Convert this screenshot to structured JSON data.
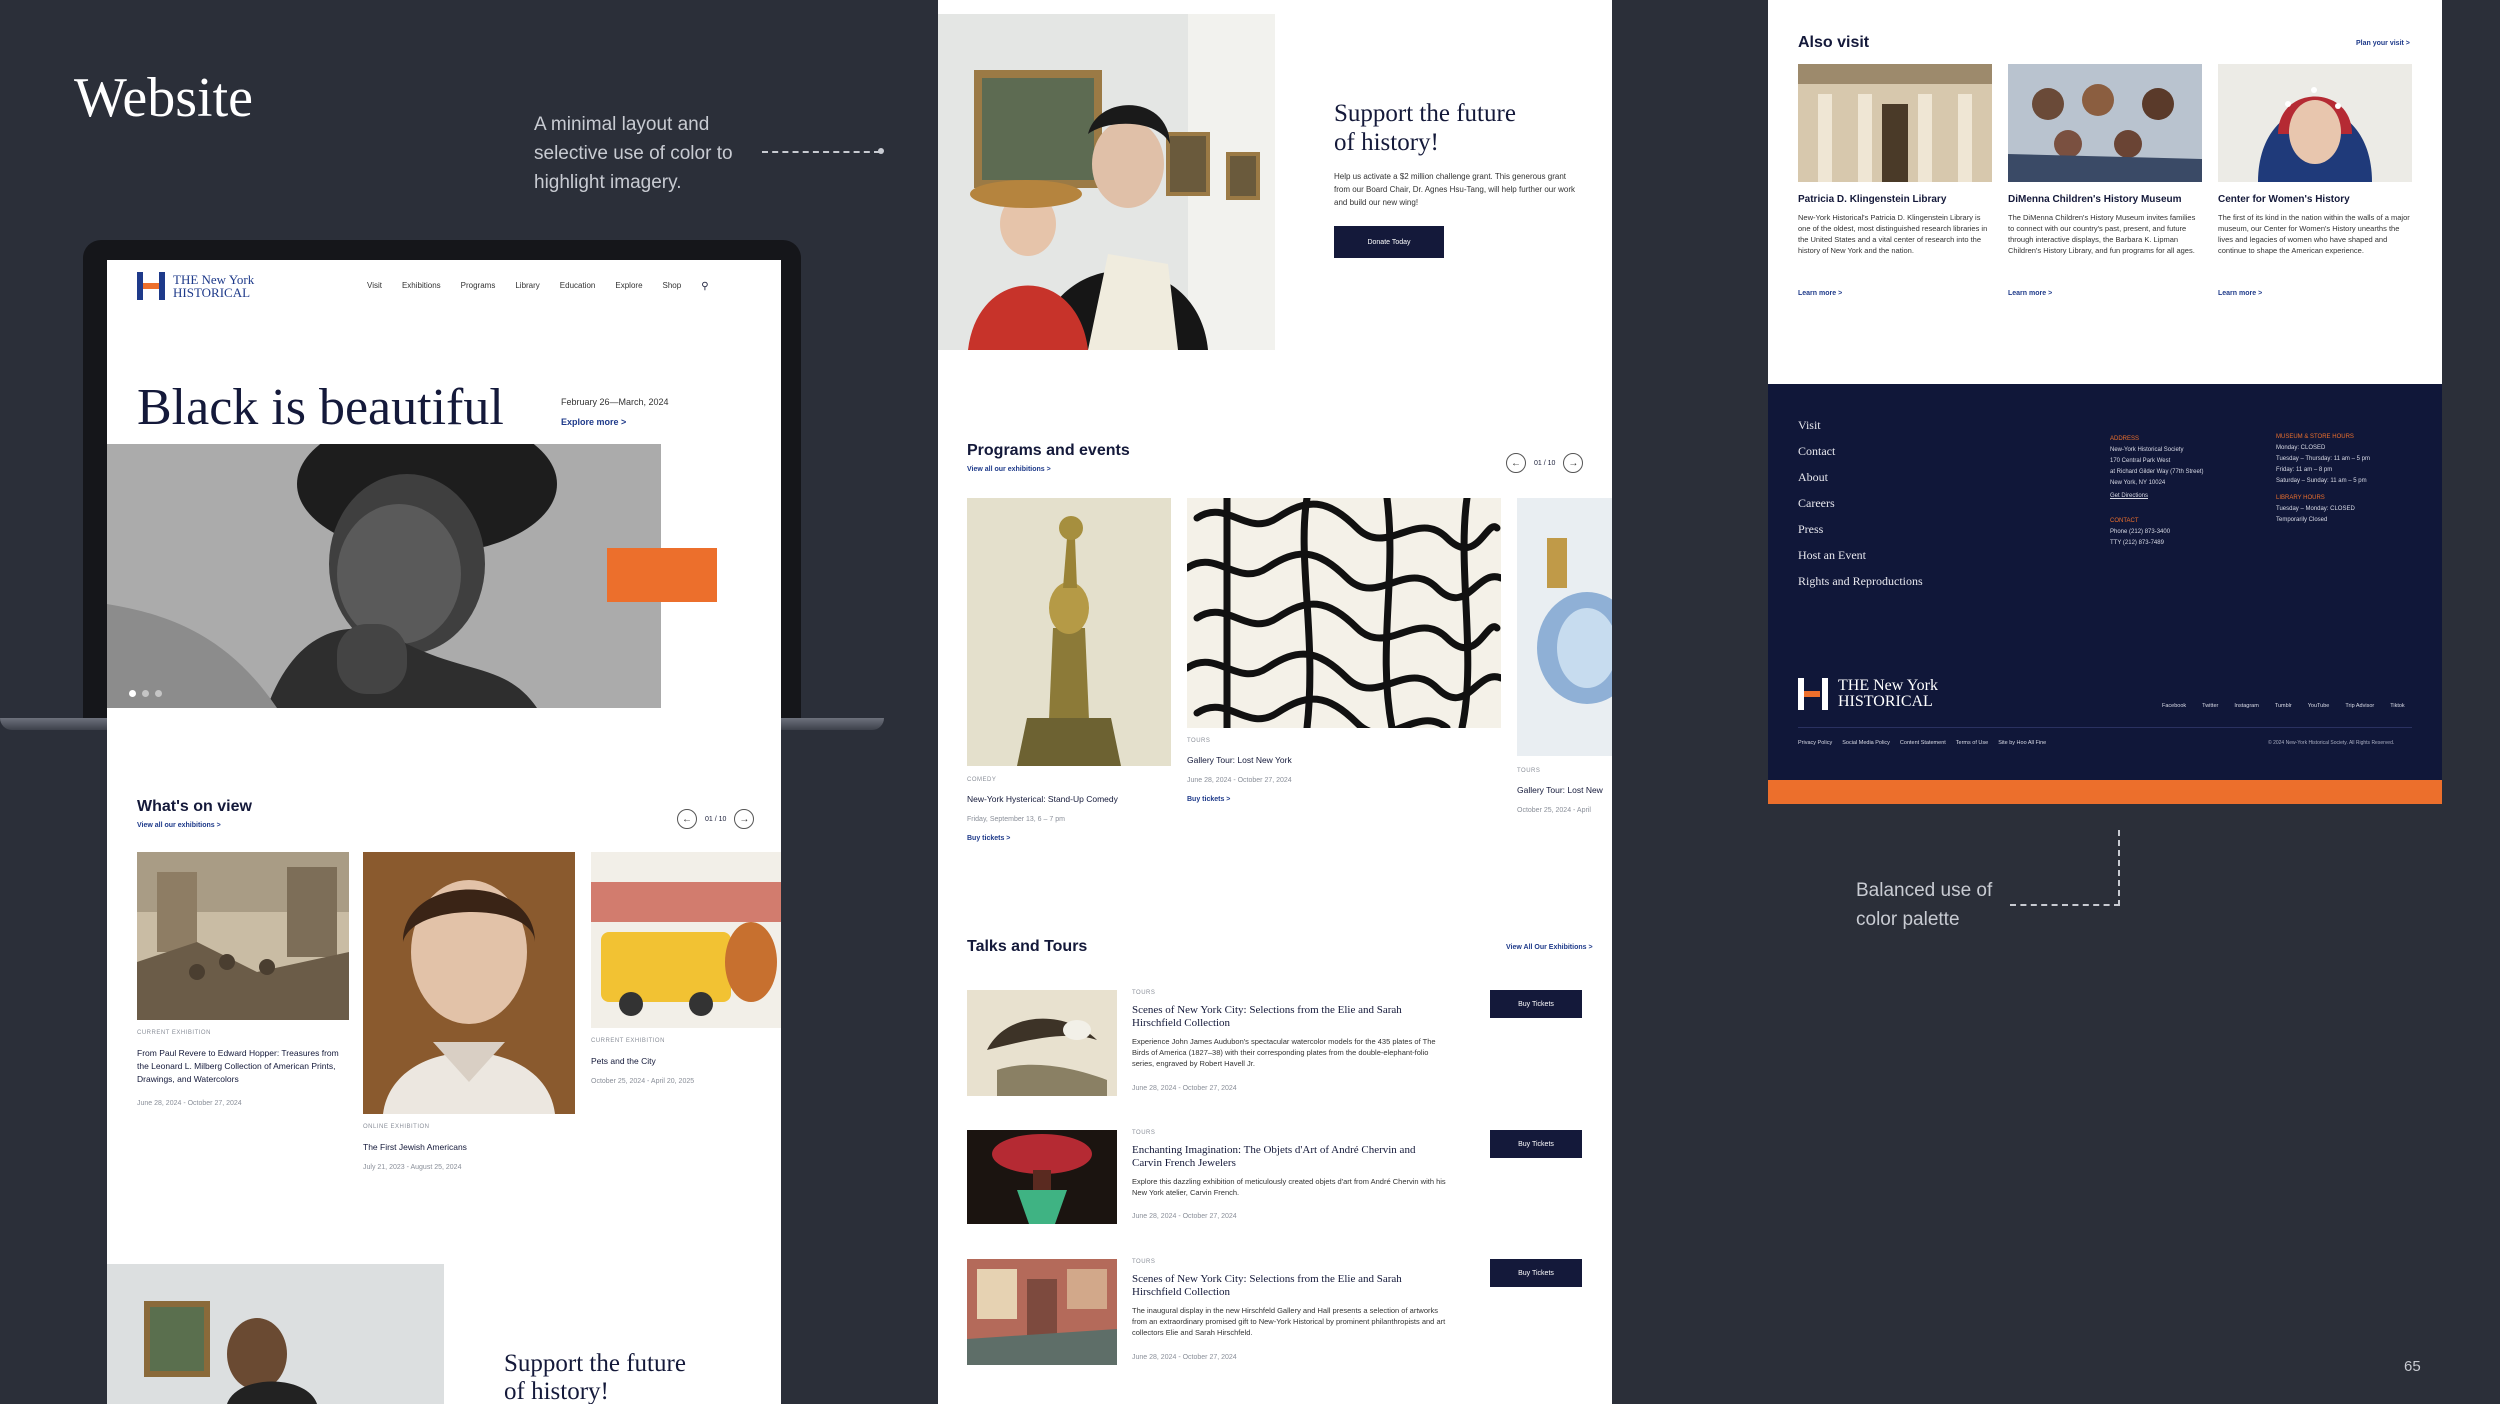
{
  "slide": {
    "title": "Website",
    "caption_top": "A minimal layout and selective use of color to highlight imagery.",
    "caption_bottom": "Balanced use of color palette",
    "page_number": "65"
  },
  "colors": {
    "navy": "#14193a",
    "orange": "#ec6f2c",
    "blue": "#1e3a8a",
    "background": "#2b2f39"
  },
  "brand": {
    "line1": "THE New York",
    "line2": "HISTORICAL"
  },
  "nav": {
    "items": [
      "Visit",
      "Exhibitions",
      "Programs",
      "Library",
      "Education",
      "Explore",
      "Shop"
    ],
    "search_icon": "search-icon"
  },
  "hero": {
    "title": "Black is beautiful",
    "dates": "February 26—March, 2024",
    "cta": "Explore more >"
  },
  "whats_on": {
    "title": "What's on view",
    "view_all": "View all our exhibitions >",
    "pager": "01 / 10",
    "cards": [
      {
        "kicker": "CURRENT EXHIBITION",
        "title": "From Paul Revere to Edward Hopper: Treasures from the Leonard L. Milberg Collection of American Prints, Drawings, and Watercolors",
        "dates": "June 28, 2024 - October 27, 2024"
      },
      {
        "kicker": "ONLINE EXHIBITION",
        "title": "The First Jewish Americans",
        "dates": "July 21, 2023 - August 25, 2024"
      },
      {
        "kicker": "CURRENT EXHIBITION",
        "title": "Pets and the City",
        "dates": "October 25, 2024 - April 20, 2025"
      }
    ]
  },
  "support": {
    "title_line1": "Support the future",
    "title_line2": "of history!",
    "body": "Help us activate a $2 million challenge grant. This generous grant from our Board Chair, Dr. Agnes Hsu-Tang, will help further our work and build our new wing!",
    "button": "Donate Today"
  },
  "programs": {
    "title": "Programs and events",
    "view_all": "View all our exhibitions >",
    "pager": "01 / 10",
    "cards": [
      {
        "kicker": "COMEDY",
        "title": "New-York Hysterical: Stand-Up Comedy",
        "dates": "Friday, September 13, 6 – 7 pm",
        "cta": "Buy tickets >"
      },
      {
        "kicker": "TOURS",
        "title": "Gallery Tour: Lost New York",
        "dates": "June 28, 2024 - October 27, 2024",
        "cta": "Buy tickets >"
      },
      {
        "kicker": "TOURS",
        "title": "Gallery Tour: Lost New",
        "dates": "October 25, 2024 - April"
      }
    ]
  },
  "talks": {
    "title": "Talks and Tours",
    "view_all": "View All Our Exhibitions >",
    "items": [
      {
        "kicker": "TOURS",
        "title": "Scenes of New York City: Selections from the Elie and Sarah Hirschfield Collection",
        "body": "Experience John James Audubon's spectacular watercolor models for the 435 plates of The Birds of America (1827–38) with their corresponding plates from the double-elephant-folio series, engraved by Robert Havell Jr.",
        "dates": "June 28, 2024 - October 27, 2024",
        "button": "Buy Tickets"
      },
      {
        "kicker": "TOURS",
        "title": "Enchanting Imagination: The Objets d'Art of André Chervin and Carvin French Jewelers",
        "body": "Explore this dazzling exhibition of meticulously created objets d'art from André Chervin with his New York atelier, Carvin French.",
        "dates": "June 28, 2024 - October 27, 2024",
        "button": "Buy Tickets"
      },
      {
        "kicker": "TOURS",
        "title": "Scenes of New York City: Selections from the Elie and Sarah Hirschfield Collection",
        "body": "The inaugural display in the new Hirschfeld Gallery and Hall presents a selection of artworks from an extraordinary promised gift to New-York Historical by prominent philanthropists and art collectors Elie and Sarah Hirschfeld.",
        "dates": "June 28, 2024 - October 27, 2024",
        "button": "Buy Tickets"
      }
    ]
  },
  "also_visit": {
    "title": "Also visit",
    "plan": "Plan your visit >",
    "cards": [
      {
        "title": "Patricia D. Klingenstein Library",
        "body": "New-York Historical's Patricia D. Klingenstein Library is one of the oldest, most distinguished research libraries in the United States and a vital center of research into the history of New York and the nation.",
        "cta": "Learn more >"
      },
      {
        "title": "DiMenna Children's History Museum",
        "body": "The DiMenna Children's History Museum invites families to connect with our country's past, present, and future through interactive displays, the Barbara K. Lipman Children's History Library, and fun programs for all ages.",
        "cta": "Learn more >"
      },
      {
        "title": "Center for Women's History",
        "body": "The first of its kind in the nation within the walls of a major museum, our Center for Women's History unearths the lives and legacies of women who have shaped and continue to shape the American experience.",
        "cta": "Learn more >"
      }
    ]
  },
  "footer": {
    "links": [
      "Visit",
      "Contact",
      "About",
      "Careers",
      "Press",
      "Host an Event",
      "Rights and Reproductions"
    ],
    "address_label": "ADDRESS",
    "address_lines": [
      "New-York Historical Society",
      "170 Central Park West",
      "at Richard Gilder Way (77th Street)",
      "New York, NY 10024"
    ],
    "directions": "Get Directions",
    "contact_label": "CONTACT",
    "contact_lines": [
      "Phone (212) 873-3400",
      "TTY  (212) 873-7489"
    ],
    "hours_label": "MUSEUM & STORE HOURS",
    "hours_lines": [
      "Monday: CLOSED",
      "Tuesday – Thursday: 11 am – 5 pm",
      "Friday: 11 am – 8 pm",
      "Saturday – Sunday: 11 am – 5 pm"
    ],
    "library_label": "LIBRARY HOURS",
    "library_lines": [
      "Tuesday – Monday: CLOSED",
      "Temporarily Closed"
    ],
    "social": [
      "Facebook",
      "Twitter",
      "Instagram",
      "Tumblr",
      "YouTube",
      "Trip Advisor",
      "Tiktok"
    ],
    "legal": [
      "Privacy Policy",
      "Social Media Policy",
      "Content Statement",
      "Terms of Use",
      "Site by Hoo All Fine"
    ],
    "copyright": "© 2024 New-York Historical Society. All Rights Reserved."
  }
}
